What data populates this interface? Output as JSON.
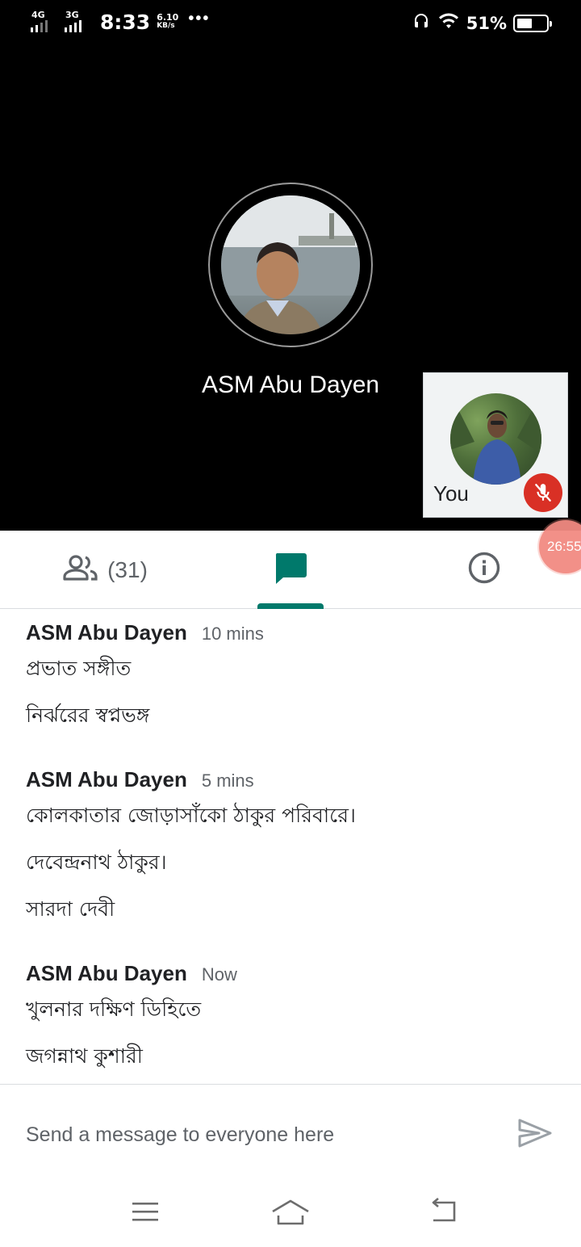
{
  "status_bar": {
    "network1": "4G",
    "network2": "3G",
    "time": "8:33",
    "speed_value": "6.10",
    "speed_unit": "KB/s",
    "more": "•••",
    "battery_percent": "51%",
    "battery_level": 0.51
  },
  "call": {
    "main_participant_name": "ASM Abu Dayen",
    "self_label": "You",
    "self_muted": true,
    "elapsed_timer": "26:55"
  },
  "tabs": {
    "people_count": "(31)",
    "active": "chat",
    "accent_color": "#00796b"
  },
  "chat": {
    "messages": [
      {
        "sender": "ASM Abu Dayen",
        "time": "10 mins",
        "lines": [
          "প্রভাত সঙ্গীত",
          "নির্ঝরের স্বপ্নভঙ্গ"
        ]
      },
      {
        "sender": "ASM Abu Dayen",
        "time": "5 mins",
        "lines": [
          "কোলকাতার জোড়াসাঁকো ঠাকুর পরিবারে।",
          "দেবেন্দ্রনাথ ঠাকুর।",
          "সারদা দেবী"
        ]
      },
      {
        "sender": "ASM Abu Dayen",
        "time": "Now",
        "lines": [
          "খুলনার দক্ষিণ ডিহিতে",
          "জগন্নাথ কুশারী"
        ]
      }
    ]
  },
  "composer": {
    "placeholder": "Send a message to everyone here",
    "value": ""
  },
  "icons": {
    "people": "people-icon",
    "chat": "chat-icon",
    "info": "info-icon",
    "send": "send-icon",
    "mic_off": "mic-off-icon",
    "menu": "menu-icon",
    "home": "home-icon",
    "back": "back-icon"
  }
}
